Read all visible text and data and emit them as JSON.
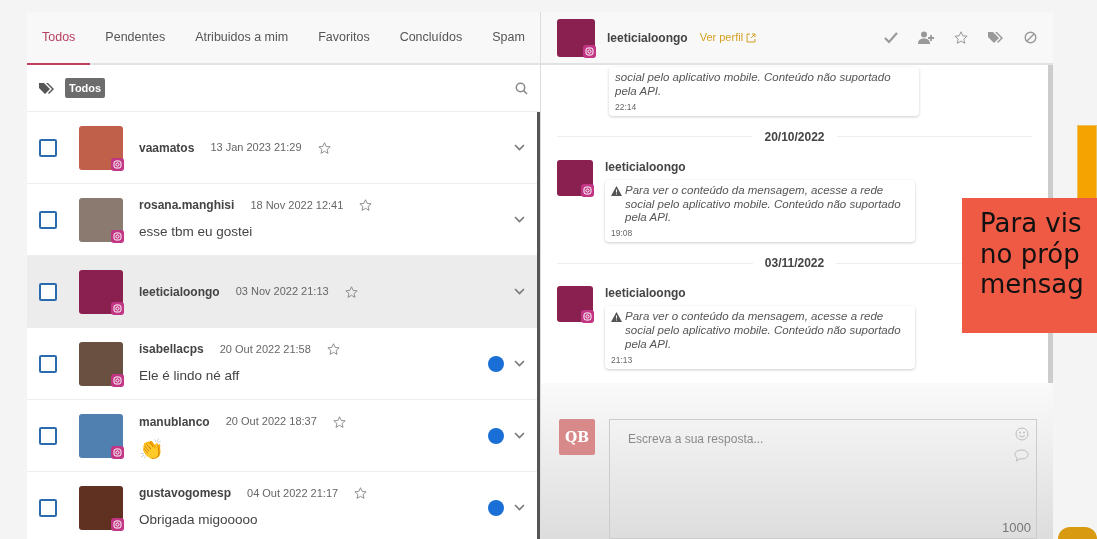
{
  "tabs": [
    {
      "label": "Todos",
      "selected": true
    },
    {
      "label": "Pendentes",
      "selected": false
    },
    {
      "label": "Atribuidos a mim",
      "selected": false
    },
    {
      "label": "Favoritos",
      "selected": false
    },
    {
      "label": "Concluídos",
      "selected": false
    },
    {
      "label": "Spam",
      "selected": false
    }
  ],
  "filter": {
    "tag": "Todos"
  },
  "conversations": [
    {
      "name": "vaamatos",
      "date": "13 Jan 2023 21:29",
      "checked": false,
      "selected": false,
      "unread": false
    },
    {
      "name": "rosana.manghisi",
      "date": "18 Nov 2022 12:41",
      "message": "esse tbm eu gostei",
      "checked": false,
      "selected": false,
      "unread": false
    },
    {
      "name": "leeticialoongo",
      "date": "03 Nov 2022 21:13",
      "checked": false,
      "selected": true,
      "unread": false
    },
    {
      "name": "isabellacps",
      "date": "20 Out 2022 21:58",
      "message": "Ele é lindo né aff",
      "checked": false,
      "selected": false,
      "unread": true
    },
    {
      "name": "manublanco",
      "date": "20 Out 2022 18:37",
      "message": "👏",
      "checked": false,
      "selected": false,
      "unread": true
    },
    {
      "name": "gustavogomesp",
      "date": "04 Out 2022 21:17",
      "message": "Obrigada migooooo",
      "checked": false,
      "selected": false,
      "unread": true
    }
  ],
  "chat": {
    "name": "leeticialoongo",
    "profile_link": "Ver perfil",
    "items": [
      {
        "kind": "message",
        "text": "social pelo aplicativo mobile. Conteúdo não suportado pela API.",
        "time": "22:14"
      },
      {
        "kind": "date",
        "text": "20/10/2022"
      },
      {
        "kind": "message",
        "sender": "leeticialoongo",
        "text": "Para ver o conteúdo da mensagem, acesse a rede social pelo aplicativo mobile. Conteúdo não suportado pela API.",
        "time": "19:08"
      },
      {
        "kind": "date",
        "text": "03/11/2022"
      },
      {
        "kind": "message",
        "sender": "leeticialoongo",
        "text": "Para ver o conteúdo da mensagem, acesse a rede social pelo aplicativo mobile. Conteúdo não suportado pela API.",
        "time": "21:13"
      }
    ],
    "composer": {
      "logo": "QB",
      "placeholder": "Escreva a sua resposta...",
      "counter": "1000"
    }
  },
  "caption": {
    "lines": [
      "Para vis",
      "no próp",
      "mensag"
    ]
  }
}
